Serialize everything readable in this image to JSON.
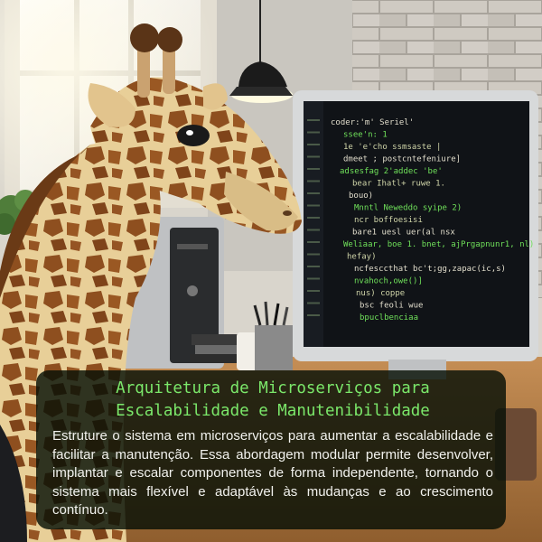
{
  "image": {
    "subject": "giraffe-looking-at-computer",
    "colors": {
      "wall_brick": "#bfbab2",
      "window": "#f4f1e6",
      "desk": "#b7814a",
      "screen": "#111418",
      "code_green": "#6fe05a",
      "caption_bg": "#06100a",
      "title_green": "#7be86a"
    }
  },
  "screen_code_lines": [
    "coder:'m' Seriel'",
    "ssee'n: 1",
    "1e 'e'cho ssmsaste |",
    "dmeet ; postcntefeniure]",
    "adsesfag 2'addec 'be'",
    "bear Ihatl+ ruwe 1.",
    "bouo)",
    "Mnntl Neweddo syipe 2)",
    "ncr boffoesisi",
    "bare1 uesl uer(al nsx",
    "Weliaar, boe 1. bnet, ajPrgapnunr1, nl)",
    "hefay)",
    "ncfesccthat bc't;gg,zapac(ic,s)",
    "nvahoch,owe()]",
    "nus) coppe",
    "bsc feoli wue",
    "bpuclbenciaa"
  ],
  "caption": {
    "title_line1": "Arquitetura de Microserviços para",
    "title_line2": "Escalabilidade e Manutenibilidade",
    "body": "Estruture o sistema em microserviços para aumentar a escalabilidade e facilitar a manutenção. Essa abordagem modular permite desenvolver, implantar e escalar componentes de forma independente, tornando o sistema mais flexível e adaptável às mudanças e ao crescimento contínuo."
  }
}
